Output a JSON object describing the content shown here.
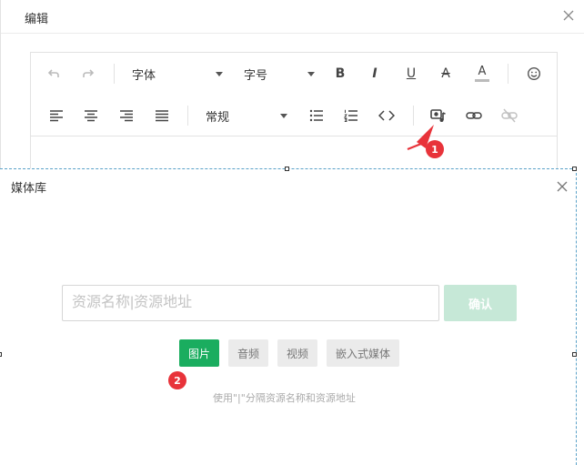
{
  "edit_dialog": {
    "title": "编辑",
    "close_icon": "close-icon"
  },
  "editor": {
    "toolbar": {
      "undo_icon": "undo-icon",
      "redo_icon": "redo-icon",
      "font_family": "字体",
      "font_size": "字号",
      "bold": "B",
      "italic": "I",
      "underline": "U",
      "strikethrough": "A",
      "font_color": "A",
      "emoji_icon": "emoji-icon",
      "align_left_icon": "align-left-icon",
      "align_center_icon": "align-center-icon",
      "align_right_icon": "align-right-icon",
      "align_justify_icon": "align-justify-icon",
      "paragraph_style": "常规",
      "bullet_list_icon": "bullet-list-icon",
      "numbered_list_icon": "numbered-list-icon",
      "code_icon": "code-icon",
      "media_icon": "media-icon",
      "link_icon": "link-icon",
      "unlink_icon": "unlink-icon"
    }
  },
  "media_dialog": {
    "title": "媒体库",
    "input_placeholder": "资源名称|资源地址",
    "confirm_label": "确认",
    "type_buttons": [
      {
        "label": "图片",
        "active": true
      },
      {
        "label": "音频",
        "active": false
      },
      {
        "label": "视频",
        "active": false
      },
      {
        "label": "嵌入式媒体",
        "active": false
      }
    ],
    "hint": "使用\"|\"分隔资源名称和资源地址"
  },
  "annotations": {
    "step1": "1",
    "step2": "2",
    "color": "#e8333a"
  },
  "colors": {
    "accent_green": "#1aad5f",
    "confirm_disabled": "#c6e8d7",
    "selection_border": "#5aa1c8"
  }
}
